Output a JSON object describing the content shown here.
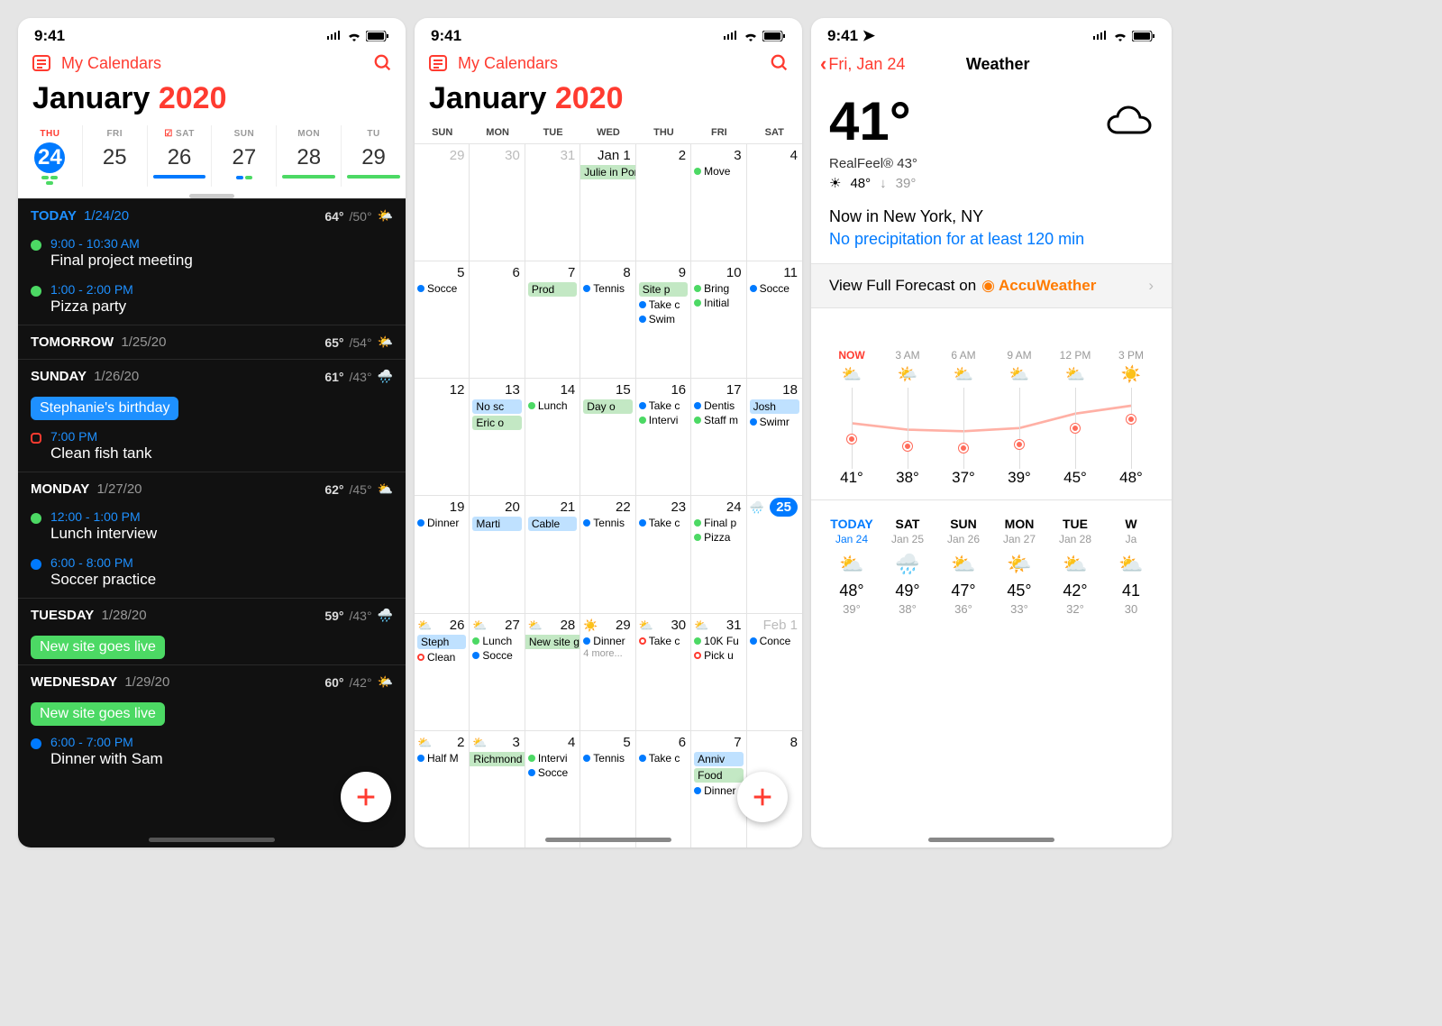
{
  "status_time": "9:41",
  "panel1": {
    "nav_label": "My Calendars",
    "month": "January",
    "year": "2020",
    "strip": [
      {
        "dow": "THU",
        "num": "24",
        "today": true
      },
      {
        "dow": "FRI",
        "num": "25"
      },
      {
        "dow": "SAT",
        "num": "26",
        "mark": true
      },
      {
        "dow": "SUN",
        "num": "27"
      },
      {
        "dow": "MON",
        "num": "28"
      },
      {
        "dow": "TU",
        "num": "29",
        "cut": true
      }
    ],
    "agenda": [
      {
        "label": "TODAY",
        "date": "1/24/20",
        "hi": "64°",
        "lo": "/50°",
        "icon": "🌤️",
        "today": true,
        "items": [
          {
            "dot": "green",
            "time": "9:00 - 10:30 AM",
            "title": "Final project meeting"
          },
          {
            "dot": "green",
            "time": "1:00 - 2:00 PM",
            "title": "Pizza party"
          }
        ]
      },
      {
        "label": "TOMORROW",
        "date": "1/25/20",
        "hi": "65°",
        "lo": "/54°",
        "icon": "🌤️"
      },
      {
        "label": "SUNDAY",
        "date": "1/26/20",
        "hi": "61°",
        "lo": "/43°",
        "icon": "🌧️",
        "badge": {
          "text": "Stephanie's birthday",
          "color": "blue"
        },
        "items": [
          {
            "dot": "outline",
            "time": "7:00 PM",
            "title": "Clean fish tank"
          }
        ]
      },
      {
        "label": "MONDAY",
        "date": "1/27/20",
        "hi": "62°",
        "lo": "/45°",
        "icon": "⛅",
        "items": [
          {
            "dot": "green",
            "time": "12:00 - 1:00 PM",
            "title": "Lunch interview"
          },
          {
            "dot": "blue",
            "time": "6:00 - 8:00 PM",
            "title": "Soccer practice"
          }
        ]
      },
      {
        "label": "TUESDAY",
        "date": "1/28/20",
        "hi": "59°",
        "lo": "/43°",
        "icon": "🌧️",
        "badge": {
          "text": "New site goes live",
          "color": "green"
        }
      },
      {
        "label": "WEDNESDAY",
        "date": "1/29/20",
        "hi": "60°",
        "lo": "/42°",
        "icon": "🌤️",
        "badge": {
          "text": "New site goes live",
          "color": "green"
        },
        "items": [
          {
            "dot": "blue",
            "time": "6:00 - 7:00 PM",
            "title": "Dinner with Sam"
          }
        ]
      }
    ]
  },
  "panel2": {
    "nav_label": "My Calendars",
    "month": "January",
    "year": "2020",
    "dow": [
      "SUN",
      "MON",
      "TUE",
      "WED",
      "THU",
      "FRI",
      "SAT"
    ],
    "weeks": [
      [
        {
          "n": "29",
          "gray": true
        },
        {
          "n": "30",
          "gray": true
        },
        {
          "n": "31",
          "gray": true
        },
        {
          "n": "Jan 1",
          "events": [
            {
              "t": "Julie in Portland",
              "bar": "green",
              "span": true
            }
          ]
        },
        {
          "n": "2"
        },
        {
          "n": "3",
          "events": [
            {
              "d": "green",
              "t": "Move"
            }
          ]
        },
        {
          "n": "4"
        }
      ],
      [
        {
          "n": "5",
          "events": [
            {
              "d": "blue",
              "t": "Socce"
            }
          ]
        },
        {
          "n": "6"
        },
        {
          "n": "7",
          "events": [
            {
              "t": "Prod",
              "bar": "green"
            }
          ]
        },
        {
          "n": "8",
          "events": [
            {
              "d": "blue",
              "t": "Tennis"
            }
          ]
        },
        {
          "n": "9",
          "events": [
            {
              "t": "Site p",
              "bar": "green"
            },
            {
              "d": "blue",
              "t": "Take c"
            },
            {
              "d": "blue",
              "t": "Swim"
            }
          ]
        },
        {
          "n": "10",
          "events": [
            {
              "d": "green",
              "t": "Bring"
            },
            {
              "d": "green",
              "t": "Initial"
            }
          ]
        },
        {
          "n": "11",
          "events": [
            {
              "d": "blue",
              "t": "Socce"
            }
          ]
        }
      ],
      [
        {
          "n": "12"
        },
        {
          "n": "13",
          "events": [
            {
              "t": "No sc",
              "bar": "blue"
            },
            {
              "t": "Eric o",
              "bar": "green"
            }
          ]
        },
        {
          "n": "14",
          "events": [
            {
              "d": "green",
              "t": "Lunch"
            }
          ]
        },
        {
          "n": "15",
          "events": [
            {
              "t": "Day o",
              "bar": "green"
            }
          ]
        },
        {
          "n": "16",
          "events": [
            {
              "d": "blue",
              "t": "Take c"
            },
            {
              "d": "green",
              "t": "Intervi"
            }
          ]
        },
        {
          "n": "17",
          "events": [
            {
              "d": "blue",
              "t": "Dentis"
            },
            {
              "d": "green",
              "t": "Staff m"
            }
          ]
        },
        {
          "n": "18",
          "events": [
            {
              "t": "Josh",
              "bar": "blue"
            },
            {
              "d": "blue",
              "t": "Swimr"
            }
          ]
        }
      ],
      [
        {
          "n": "19",
          "events": [
            {
              "d": "blue",
              "t": "Dinner"
            }
          ]
        },
        {
          "n": "20",
          "events": [
            {
              "t": "Marti",
              "bar": "blue"
            }
          ]
        },
        {
          "n": "21",
          "events": [
            {
              "t": "Cable",
              "bar": "blue"
            }
          ]
        },
        {
          "n": "22",
          "events": [
            {
              "d": "blue",
              "t": "Tennis"
            }
          ]
        },
        {
          "n": "23",
          "events": [
            {
              "d": "blue",
              "t": "Take c"
            }
          ]
        },
        {
          "n": "24",
          "events": [
            {
              "d": "green",
              "t": "Final p"
            },
            {
              "d": "green",
              "t": "Pizza"
            }
          ]
        },
        {
          "n": "25",
          "today": true,
          "wicon": "🌧️"
        }
      ],
      [
        {
          "n": "26",
          "wicon": "⛅",
          "events": [
            {
              "t": "Steph",
              "bar": "blue"
            },
            {
              "d": "orange",
              "t": "Clean"
            }
          ]
        },
        {
          "n": "27",
          "wicon": "⛅",
          "events": [
            {
              "d": "green",
              "t": "Lunch"
            },
            {
              "d": "blue",
              "t": "Socce"
            }
          ]
        },
        {
          "n": "28",
          "wicon": "⛅",
          "events": [
            {
              "t": "New site goes live",
              "bar": "green",
              "span": true
            }
          ]
        },
        {
          "n": "29",
          "wicon": "☀️",
          "events": [
            {
              "d": "blue",
              "t": "Dinner"
            },
            {
              "more": "4 more..."
            }
          ]
        },
        {
          "n": "30",
          "wicon": "⛅",
          "events": [
            {
              "d": "orange",
              "t": "Take c"
            }
          ]
        },
        {
          "n": "31",
          "wicon": "⛅",
          "events": [
            {
              "d": "green",
              "t": "10K Fu"
            },
            {
              "d": "orange",
              "t": "Pick u"
            }
          ]
        },
        {
          "n": "Feb 1",
          "gray": true,
          "events": [
            {
              "d": "blue",
              "t": "Conce"
            }
          ]
        }
      ],
      [
        {
          "n": "2",
          "wicon": "⛅",
          "events": [
            {
              "d": "blue",
              "t": "Half M"
            }
          ]
        },
        {
          "n": "3",
          "wicon": "⛅",
          "events": [
            {
              "t": "Richmond",
              "bar": "green",
              "span": true
            }
          ]
        },
        {
          "n": "4",
          "events": [
            {
              "d": "green",
              "t": "Intervi"
            },
            {
              "d": "blue",
              "t": "Socce"
            }
          ]
        },
        {
          "n": "5",
          "events": [
            {
              "d": "blue",
              "t": "Tennis"
            }
          ]
        },
        {
          "n": "6",
          "events": [
            {
              "d": "blue",
              "t": "Take c"
            }
          ]
        },
        {
          "n": "7",
          "events": [
            {
              "t": "Anniv",
              "bar": "blue"
            },
            {
              "t": "Food",
              "bar": "green"
            },
            {
              "d": "blue",
              "t": "Dinner"
            }
          ]
        },
        {
          "n": "8"
        }
      ]
    ]
  },
  "panel3": {
    "back": "Fri, Jan 24",
    "title": "Weather",
    "temp": "41°",
    "realfeel": "RealFeel® 43°",
    "hi": "48°",
    "lo": "39°",
    "loc": "Now in New York, NY",
    "precip": "No precipitation for at least 120 min",
    "accu_prefix": "View Full Forecast on",
    "accu_brand": "AccuWeather",
    "hourly": [
      {
        "l": "NOW",
        "icon": "⛅",
        "t": "41°",
        "y": 52
      },
      {
        "l": "3 AM",
        "icon": "🌤️",
        "t": "38°",
        "y": 60
      },
      {
        "l": "6 AM",
        "icon": "⛅",
        "t": "37°",
        "y": 62
      },
      {
        "l": "9 AM",
        "icon": "⛅",
        "t": "39°",
        "y": 58
      },
      {
        "l": "12 PM",
        "icon": "⛅",
        "t": "45°",
        "y": 40
      },
      {
        "l": "3 PM",
        "icon": "☀️",
        "t": "48°",
        "y": 30
      }
    ],
    "daily": [
      {
        "l": "TODAY",
        "sub": "Jan 24",
        "icon": "⛅",
        "hi": "48°",
        "lo": "39°",
        "today": true
      },
      {
        "l": "SAT",
        "sub": "Jan 25",
        "icon": "🌧️",
        "hi": "49°",
        "lo": "38°"
      },
      {
        "l": "SUN",
        "sub": "Jan 26",
        "icon": "⛅",
        "hi": "47°",
        "lo": "36°"
      },
      {
        "l": "MON",
        "sub": "Jan 27",
        "icon": "🌤️",
        "hi": "45°",
        "lo": "33°"
      },
      {
        "l": "TUE",
        "sub": "Jan 28",
        "icon": "⛅",
        "hi": "42°",
        "lo": "32°"
      },
      {
        "l": "W",
        "sub": "Ja",
        "icon": "⛅",
        "hi": "41",
        "lo": "30"
      }
    ]
  }
}
